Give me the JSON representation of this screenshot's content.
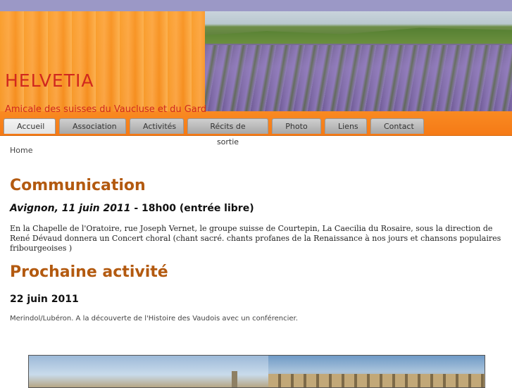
{
  "header": {
    "site_title": "HELVETIA",
    "subtitle": "Amicale des suisses du Vaucluse et du Gard"
  },
  "nav": {
    "items": [
      {
        "label": "Accueil",
        "active": true
      },
      {
        "label": "Association"
      },
      {
        "label": "Activités"
      },
      {
        "label": "Récits de sortie"
      },
      {
        "label": "Photo"
      },
      {
        "label": "Liens"
      },
      {
        "label": "Contact"
      }
    ]
  },
  "breadcrumb": "Home",
  "communication": {
    "heading": "Communication",
    "event_place_date": "Avignon, 11 juin 2011",
    "event_time": " - 18h00 (entrée libre)",
    "text": "En la Chapelle de l'Oratoire, rue Joseph Vernet,  le groupe suisse de Courtepin, La Caecilia du Rosaire, sous la direction de René Dévaud donnera un Concert choral  (chant sacré. chants profanes de la Renaissance à nos jours et chansons populaires fribourgeoises )"
  },
  "next_activity": {
    "heading": "Prochaine activité",
    "date": "22 juin 2011",
    "text": "Merindol/Lubéron. A la découverte de l'Histoire des Vaudois avec un conférencier."
  },
  "colors": {
    "accent_orange": "#f57a16",
    "title_red": "#d1281e",
    "heading_brown": "#b35a10",
    "top_band": "#9b98c6"
  }
}
